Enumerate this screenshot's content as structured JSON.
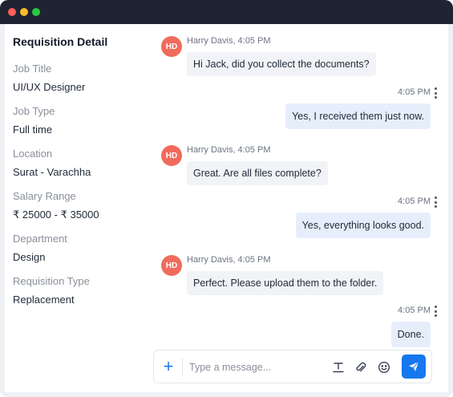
{
  "window": {
    "controls": [
      "close",
      "minimize",
      "maximize"
    ]
  },
  "sidebar": {
    "title": "Requisition Detail",
    "fields": [
      {
        "label": "Job Title",
        "value": "UI/UX Designer"
      },
      {
        "label": "Job Type",
        "value": "Full time"
      },
      {
        "label": "Location",
        "value": "Surat - Varachha"
      },
      {
        "label": "Salary Range",
        "value": "₹ 25000 - ₹ 35000"
      },
      {
        "label": "Department",
        "value": "Design"
      },
      {
        "label": "Requisition Type",
        "value": "Replacement"
      }
    ]
  },
  "chat": {
    "messages": [
      {
        "direction": "in",
        "avatar": "HD",
        "meta": "Harry Davis, 4:05 PM",
        "text": "Hi Jack, did you collect the documents?"
      },
      {
        "direction": "out",
        "meta": "4:05 PM",
        "text": "Yes, I received them just now."
      },
      {
        "direction": "in",
        "avatar": "HD",
        "meta": "Harry Davis, 4:05 PM",
        "text": "Great. Are all files complete?"
      },
      {
        "direction": "out",
        "meta": "4:05 PM",
        "text": "Yes, everything looks good."
      },
      {
        "direction": "in",
        "avatar": "HD",
        "meta": "Harry Davis, 4:05 PM",
        "text": "Perfect. Please upload them to the folder."
      },
      {
        "direction": "out",
        "meta": "4:05 PM",
        "text": "Done."
      }
    ]
  },
  "composer": {
    "placeholder": "Type a message...",
    "value": "",
    "icons": [
      "plus-icon",
      "text-format-icon",
      "attachment-icon",
      "emoji-icon",
      "send-icon"
    ]
  },
  "colors": {
    "accent": "#1677ee",
    "avatar": "#f06b5c",
    "titlebar": "#1f2433",
    "incoming_bubble": "#f1f3f6",
    "outgoing_bubble": "#e7eefb"
  }
}
